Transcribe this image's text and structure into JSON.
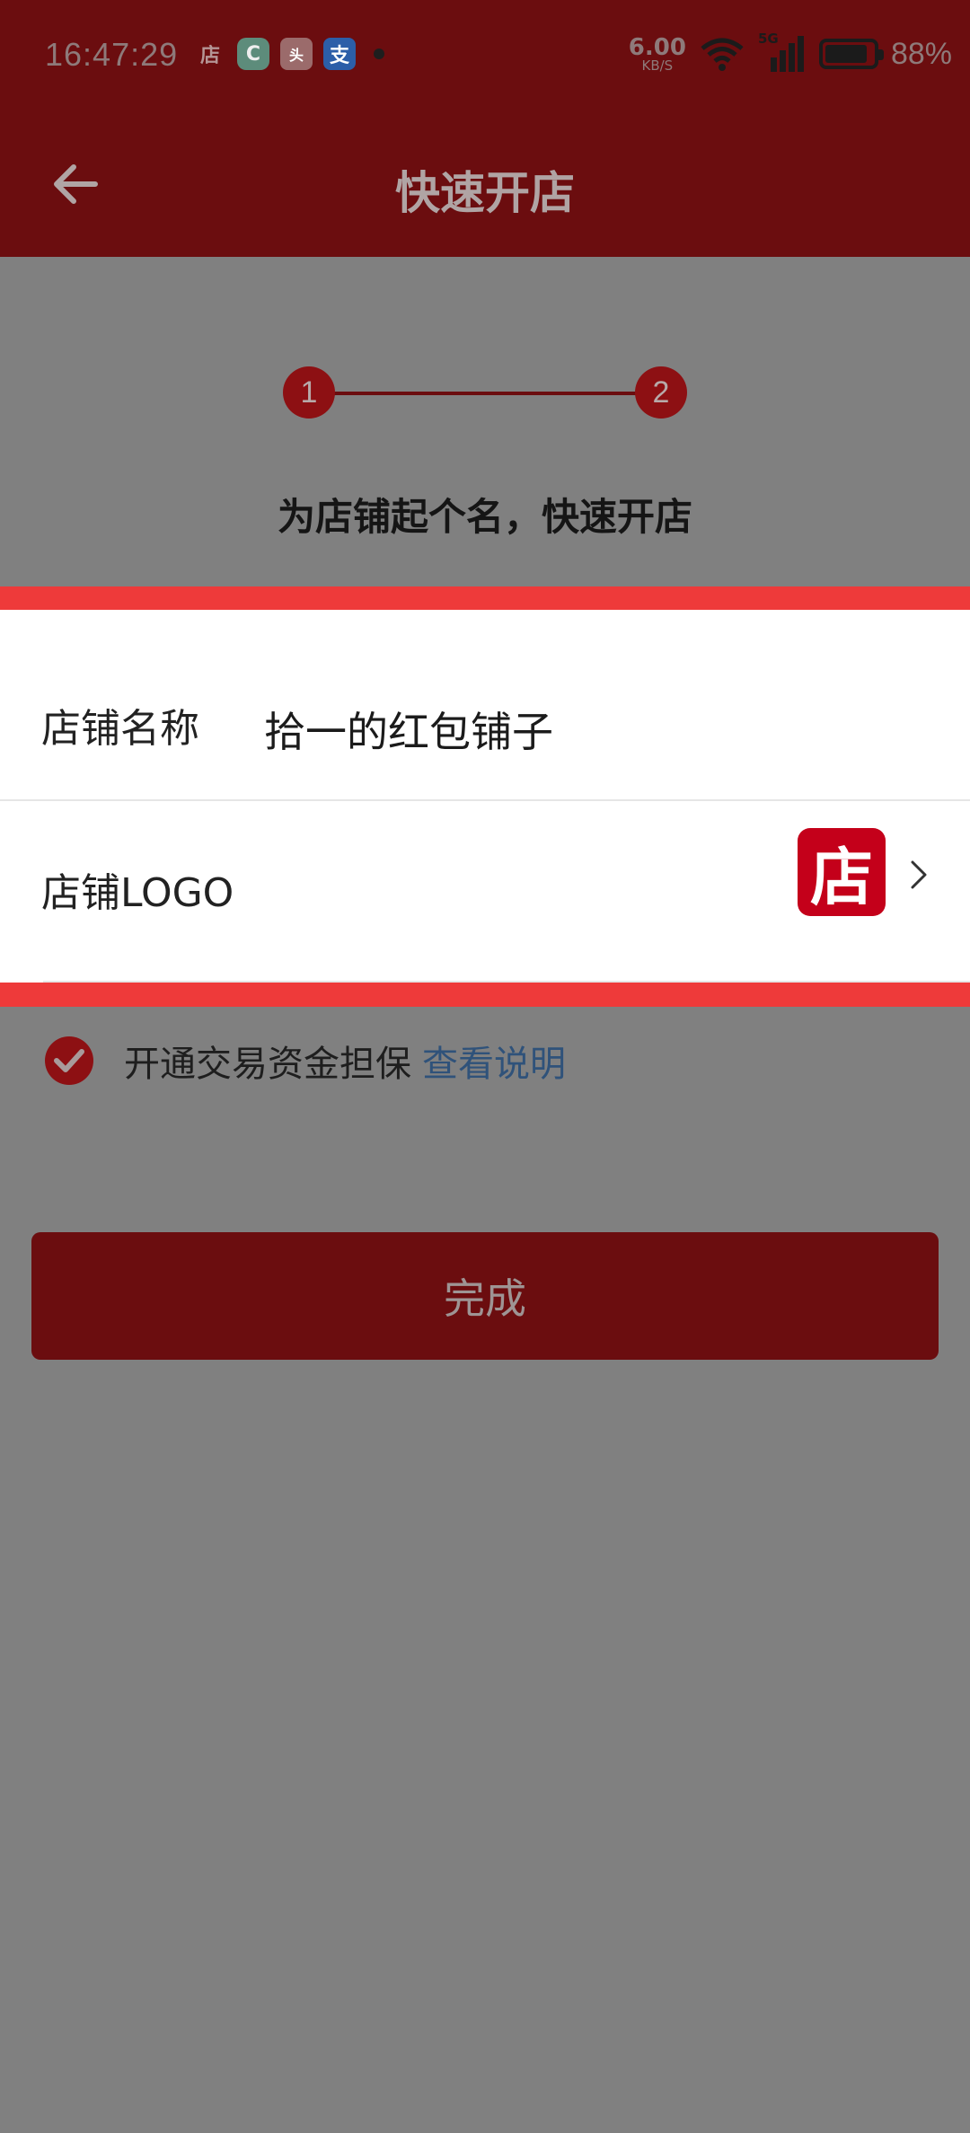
{
  "status_bar": {
    "time": "16:47:29",
    "apps": [
      {
        "icon": "dian-app-icon",
        "glyph": "店"
      },
      {
        "icon": "refresh-app-icon",
        "glyph": "C"
      },
      {
        "icon": "toutiao-app-icon",
        "glyph": "头"
      },
      {
        "icon": "alipay-app-icon",
        "glyph": "支"
      }
    ],
    "net_speed": "6.00",
    "net_unit": "KB/S",
    "signal": "5G",
    "battery": "88%",
    "battery_level": 0.88
  },
  "app_bar": {
    "title": "快速开店",
    "back_icon": "back-arrow-icon"
  },
  "steps": {
    "step1": "1",
    "step2": "2",
    "tagline": "为店铺起个名，快速开店"
  },
  "form": {
    "name_label": "店铺名称",
    "name_value": "拾一的红包铺子",
    "logo_label": "店铺LOGO",
    "logo_glyph": "店"
  },
  "guarantee": {
    "text": "开通交易资金担保",
    "link": "查看说明"
  },
  "actions": {
    "done_label": "完成"
  },
  "colors": {
    "brand_dark": "#6b0d0f",
    "highlight": "#ee3a3a",
    "logo_red": "#c4001a",
    "link_blue": "#2f527a"
  }
}
